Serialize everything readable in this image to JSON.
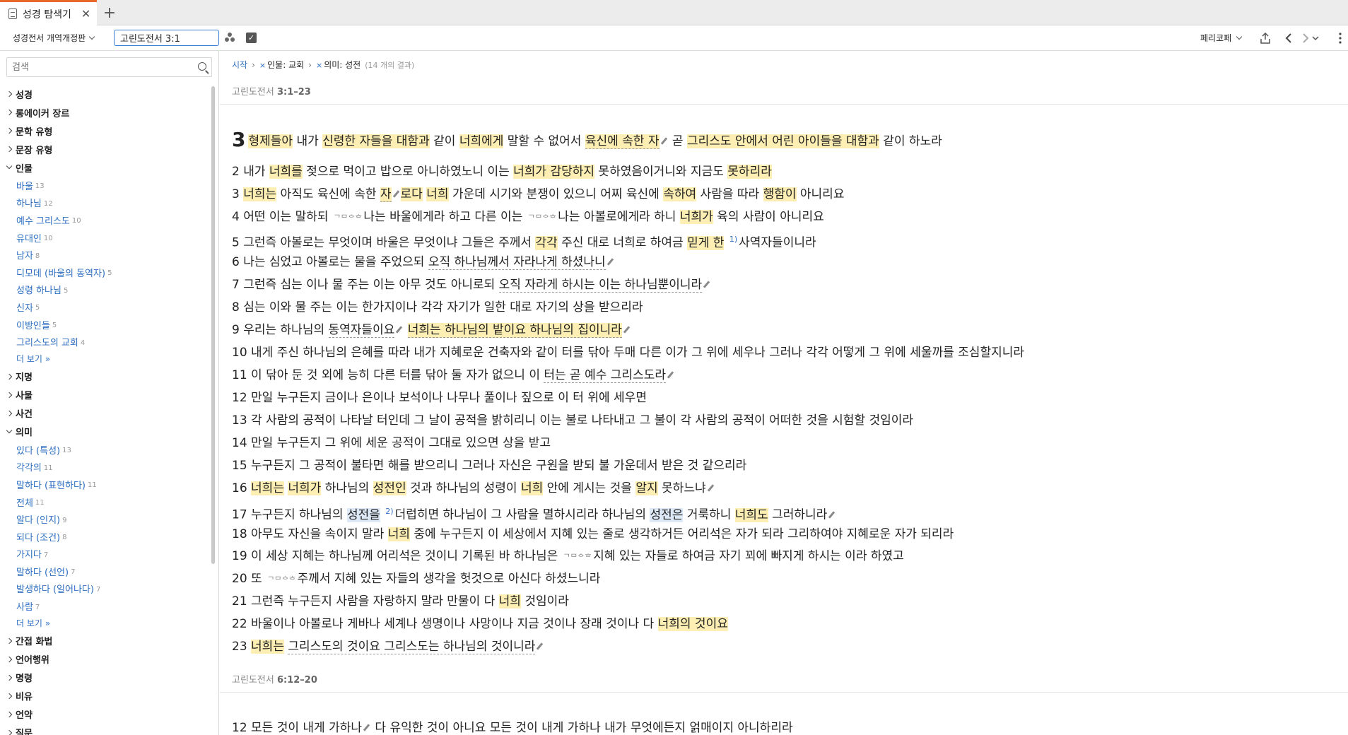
{
  "tab": {
    "title": "성경 탐색기",
    "close": "✕",
    "new": "+"
  },
  "toolbar": {
    "resource": "성경전서 개역개정판",
    "reference": "고린도전서 3:1",
    "parallel": "페리코페"
  },
  "sidebar": {
    "search_placeholder": "검색",
    "facets_top": [
      "성경",
      "롱에이커 장르",
      "문학 유형",
      "문장 유형"
    ],
    "people": {
      "label": "인물",
      "items": [
        {
          "label": "바울",
          "count": "13"
        },
        {
          "label": "하나님",
          "count": "12"
        },
        {
          "label": "예수 그리스도",
          "count": "10"
        },
        {
          "label": "유대인",
          "count": "10"
        },
        {
          "label": "남자",
          "count": "8"
        },
        {
          "label": "디모데 (바울의 동역자)",
          "count": "5"
        },
        {
          "label": "성령 하나님",
          "count": "5"
        },
        {
          "label": "신자",
          "count": "5"
        },
        {
          "label": "이방인들",
          "count": "5"
        },
        {
          "label": "그리스도의 교회",
          "count": "4"
        }
      ],
      "more": "더 보기 »"
    },
    "facets_mid": [
      "지명",
      "사물",
      "사건"
    ],
    "meaning": {
      "label": "의미",
      "items": [
        {
          "label": "있다 (특성)",
          "count": "13"
        },
        {
          "label": "각각의",
          "count": "11"
        },
        {
          "label": "말하다 (표현하다)",
          "count": "11"
        },
        {
          "label": "전체",
          "count": "11"
        },
        {
          "label": "알다 (인지)",
          "count": "9"
        },
        {
          "label": "되다 (조건)",
          "count": "8"
        },
        {
          "label": "가지다",
          "count": "7"
        },
        {
          "label": "말하다 (선언)",
          "count": "7"
        },
        {
          "label": "발생하다 (일어나다)",
          "count": "7"
        },
        {
          "label": "사람",
          "count": "7"
        }
      ],
      "more": "더 보기 »"
    },
    "facets_bottom": [
      "간접 화법",
      "언어행위",
      "명령",
      "비유",
      "언약",
      "질문"
    ]
  },
  "main": {
    "crumb_start": "시작",
    "crumb_sep": "›",
    "crumb_x": "×",
    "crumb_1": "인물: 교회",
    "crumb_2": "의미: 성전",
    "crumb_results": "(14 개의 결과)",
    "passage1": {
      "book": "고린도전서",
      "range": "3:1–23"
    },
    "passage2": {
      "book": "고린도전서",
      "range": "6:12–20"
    },
    "hebrew_icon": "ᄀᄆᅌᄒ"
  }
}
